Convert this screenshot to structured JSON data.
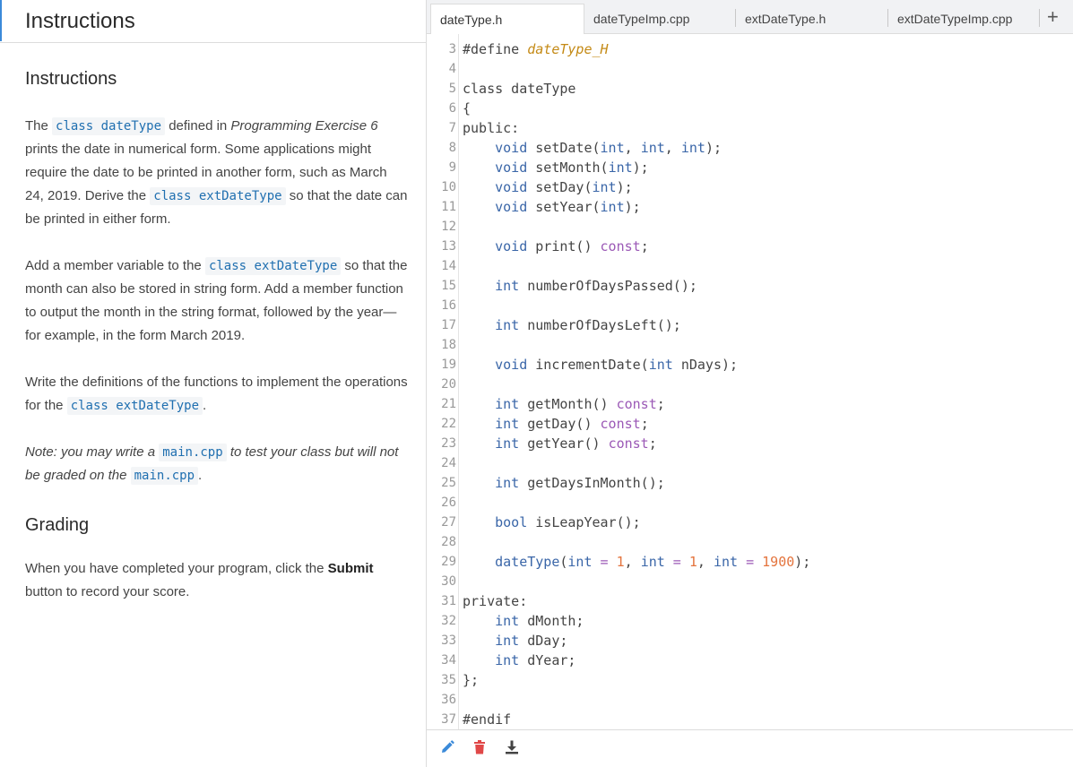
{
  "left_panel": {
    "title": "Instructions",
    "section_instructions": "Instructions",
    "p1": {
      "t1": "The ",
      "c1": "class dateType",
      "t2": " defined in ",
      "em1": "Programming Exercise 6",
      "t3": " prints the date in numerical form. Some applications might require the date to be printed in another form, such as March 24, 2019. Derive the ",
      "c2": "class extDateType",
      "t4": " so that the date can be printed in either form."
    },
    "p2": {
      "t1": "Add a member variable to the ",
      "c1": "class extDateType",
      "t2": " so that the month can also be stored in string form. Add a member function to output the month in the string format, followed by the year—for example, in the form March 2019."
    },
    "p3": {
      "t1": "Write the definitions of the functions to implement the operations for the ",
      "c1": "class extDateType",
      "t2": "."
    },
    "p4": {
      "t1": "Note: you may write a ",
      "c1": "main.cpp",
      "t2": " to test your class but will not be graded on the ",
      "c2": "main.cpp",
      "t3": "."
    },
    "section_grading": "Grading",
    "p5": {
      "t1": "When you have completed your program, click the ",
      "b1": "Submit",
      "t2": " button to record your score."
    }
  },
  "tabs": [
    {
      "label": "dateType.h",
      "active": true
    },
    {
      "label": "dateTypeImp.cpp",
      "active": false
    },
    {
      "label": "extDateType.h",
      "active": false
    },
    {
      "label": "extDateTypeImp.cpp",
      "active": false
    }
  ],
  "add_tab_label": "+",
  "code_lines": [
    {
      "n": "3",
      "tokens": [
        [
          "pp",
          "#define "
        ],
        [
          "mac",
          "dateType_H"
        ]
      ]
    },
    {
      "n": "4",
      "tokens": []
    },
    {
      "n": "5",
      "tokens": [
        [
          "plain",
          "class dateType"
        ]
      ]
    },
    {
      "n": "6",
      "tokens": [
        [
          "plain",
          "{"
        ]
      ]
    },
    {
      "n": "7",
      "tokens": [
        [
          "plain",
          "public:"
        ]
      ]
    },
    {
      "n": "8",
      "tokens": [
        [
          "plain",
          "    "
        ],
        [
          "kw",
          "void"
        ],
        [
          "plain",
          " setDate("
        ],
        [
          "kw",
          "int"
        ],
        [
          "plain",
          ", "
        ],
        [
          "kw",
          "int"
        ],
        [
          "plain",
          ", "
        ],
        [
          "kw",
          "int"
        ],
        [
          "plain",
          ");"
        ]
      ]
    },
    {
      "n": "9",
      "tokens": [
        [
          "plain",
          "    "
        ],
        [
          "kw",
          "void"
        ],
        [
          "plain",
          " setMonth("
        ],
        [
          "kw",
          "int"
        ],
        [
          "plain",
          ");"
        ]
      ]
    },
    {
      "n": "10",
      "tokens": [
        [
          "plain",
          "    "
        ],
        [
          "kw",
          "void"
        ],
        [
          "plain",
          " setDay("
        ],
        [
          "kw",
          "int"
        ],
        [
          "plain",
          ");"
        ]
      ]
    },
    {
      "n": "11",
      "tokens": [
        [
          "plain",
          "    "
        ],
        [
          "kw",
          "void"
        ],
        [
          "plain",
          " setYear("
        ],
        [
          "kw",
          "int"
        ],
        [
          "plain",
          ");"
        ]
      ]
    },
    {
      "n": "12",
      "tokens": []
    },
    {
      "n": "13",
      "tokens": [
        [
          "plain",
          "    "
        ],
        [
          "kw",
          "void"
        ],
        [
          "plain",
          " print() "
        ],
        [
          "op",
          "const"
        ],
        [
          "plain",
          ";"
        ]
      ]
    },
    {
      "n": "14",
      "tokens": []
    },
    {
      "n": "15",
      "tokens": [
        [
          "plain",
          "    "
        ],
        [
          "kw",
          "int"
        ],
        [
          "plain",
          " numberOfDaysPassed();"
        ]
      ]
    },
    {
      "n": "16",
      "tokens": []
    },
    {
      "n": "17",
      "tokens": [
        [
          "plain",
          "    "
        ],
        [
          "kw",
          "int"
        ],
        [
          "plain",
          " numberOfDaysLeft();"
        ]
      ]
    },
    {
      "n": "18",
      "tokens": []
    },
    {
      "n": "19",
      "tokens": [
        [
          "plain",
          "    "
        ],
        [
          "kw",
          "void"
        ],
        [
          "plain",
          " incrementDate("
        ],
        [
          "kw",
          "int"
        ],
        [
          "plain",
          " nDays);"
        ]
      ]
    },
    {
      "n": "20",
      "tokens": []
    },
    {
      "n": "21",
      "tokens": [
        [
          "plain",
          "    "
        ],
        [
          "kw",
          "int"
        ],
        [
          "plain",
          " getMonth() "
        ],
        [
          "op",
          "const"
        ],
        [
          "plain",
          ";"
        ]
      ]
    },
    {
      "n": "22",
      "tokens": [
        [
          "plain",
          "    "
        ],
        [
          "kw",
          "int"
        ],
        [
          "plain",
          " getDay() "
        ],
        [
          "op",
          "const"
        ],
        [
          "plain",
          ";"
        ]
      ]
    },
    {
      "n": "23",
      "tokens": [
        [
          "plain",
          "    "
        ],
        [
          "kw",
          "int"
        ],
        [
          "plain",
          " getYear() "
        ],
        [
          "op",
          "const"
        ],
        [
          "plain",
          ";"
        ]
      ]
    },
    {
      "n": "24",
      "tokens": []
    },
    {
      "n": "25",
      "tokens": [
        [
          "plain",
          "    "
        ],
        [
          "kw",
          "int"
        ],
        [
          "plain",
          " getDaysInMonth();"
        ]
      ]
    },
    {
      "n": "26",
      "tokens": []
    },
    {
      "n": "27",
      "tokens": [
        [
          "plain",
          "    "
        ],
        [
          "kw",
          "bool"
        ],
        [
          "plain",
          " isLeapYear();"
        ]
      ]
    },
    {
      "n": "28",
      "tokens": []
    },
    {
      "n": "29",
      "tokens": [
        [
          "plain",
          "    "
        ],
        [
          "kw",
          "dateType"
        ],
        [
          "plain",
          "("
        ],
        [
          "kw",
          "int"
        ],
        [
          "op",
          " = "
        ],
        [
          "num",
          "1"
        ],
        [
          "plain",
          ", "
        ],
        [
          "kw",
          "int"
        ],
        [
          "op",
          " = "
        ],
        [
          "num",
          "1"
        ],
        [
          "plain",
          ", "
        ],
        [
          "kw",
          "int"
        ],
        [
          "op",
          " = "
        ],
        [
          "num",
          "1900"
        ],
        [
          "plain",
          ");"
        ]
      ]
    },
    {
      "n": "30",
      "tokens": []
    },
    {
      "n": "31",
      "tokens": [
        [
          "plain",
          "private:"
        ]
      ]
    },
    {
      "n": "32",
      "tokens": [
        [
          "plain",
          "    "
        ],
        [
          "kw",
          "int"
        ],
        [
          "plain",
          " dMonth;"
        ]
      ]
    },
    {
      "n": "33",
      "tokens": [
        [
          "plain",
          "    "
        ],
        [
          "kw",
          "int"
        ],
        [
          "plain",
          " dDay;"
        ]
      ]
    },
    {
      "n": "34",
      "tokens": [
        [
          "plain",
          "    "
        ],
        [
          "kw",
          "int"
        ],
        [
          "plain",
          " dYear;"
        ]
      ]
    },
    {
      "n": "35",
      "tokens": [
        [
          "plain",
          "};"
        ]
      ]
    },
    {
      "n": "36",
      "tokens": []
    },
    {
      "n": "37",
      "tokens": [
        [
          "pp",
          "#endif"
        ]
      ]
    }
  ],
  "toolbar": {
    "edit_icon": "pencil-icon",
    "delete_icon": "trash-icon",
    "download_icon": "download-icon",
    "edit_color": "#3b8ad9",
    "delete_color": "#e04848",
    "download_color": "#444444"
  }
}
